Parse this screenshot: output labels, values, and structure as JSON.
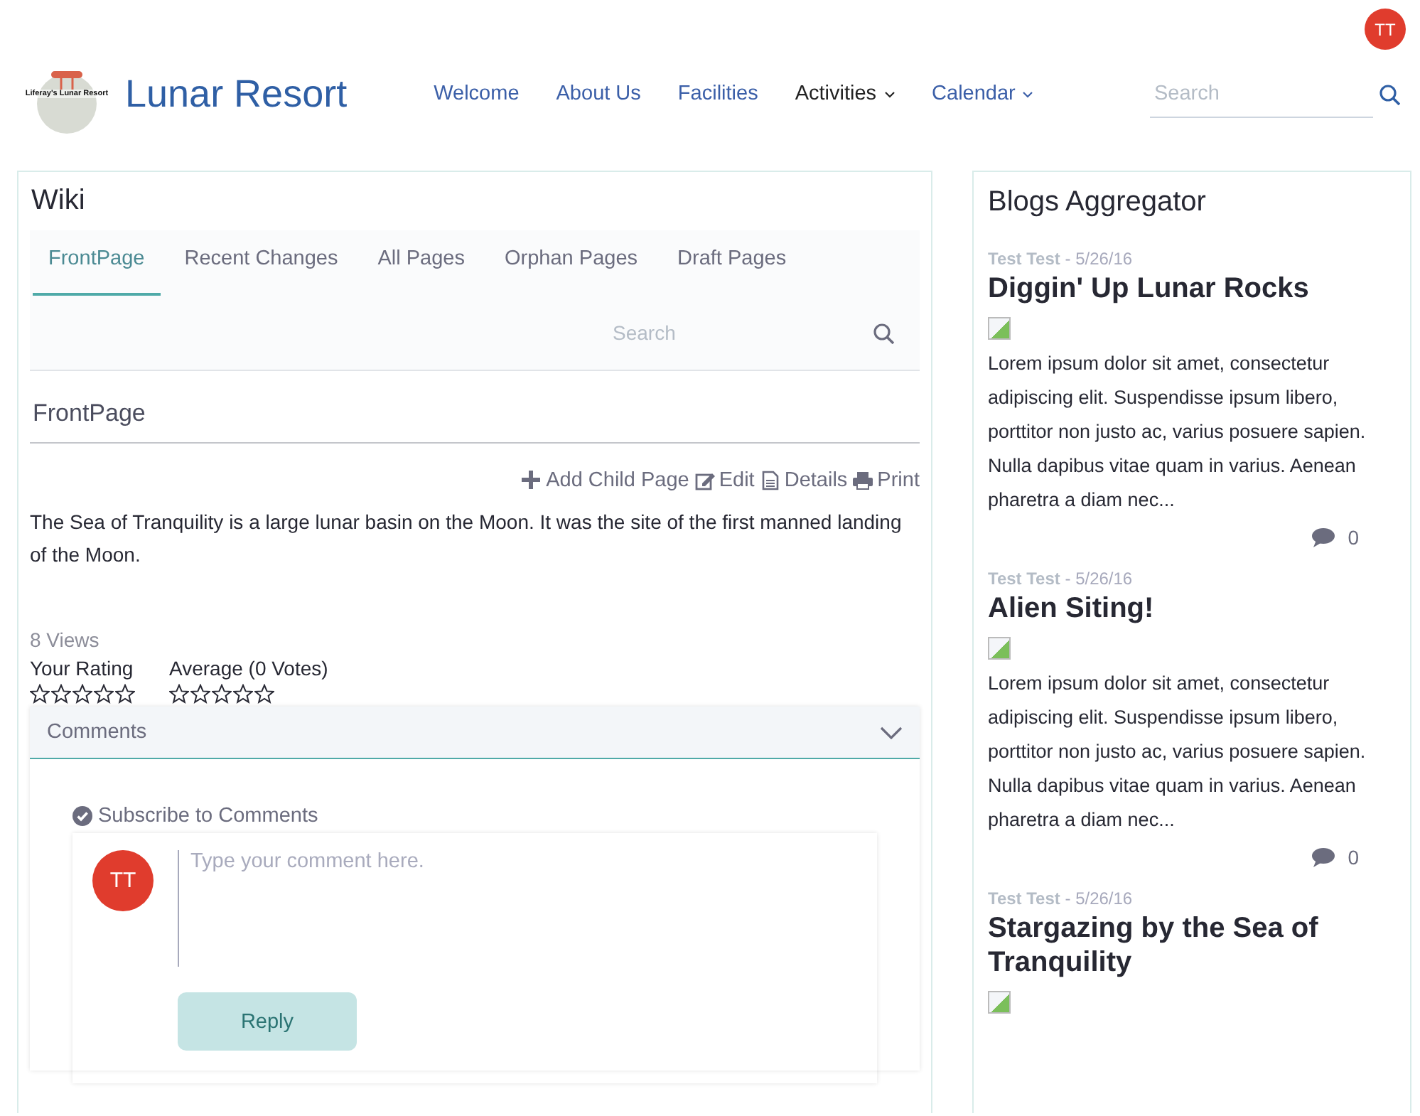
{
  "header": {
    "user_initials": "TT",
    "logo_text": "Liferay's Lunar Resort",
    "site_title": "Lunar Resort",
    "nav": [
      {
        "label": "Welcome",
        "selected": false,
        "kind": "link"
      },
      {
        "label": "About Us",
        "selected": false,
        "kind": "link"
      },
      {
        "label": "Facilities",
        "selected": false,
        "kind": "link"
      },
      {
        "label": "Activities",
        "selected": true,
        "kind": "dropdown"
      },
      {
        "label": "Calendar",
        "selected": false,
        "kind": "dropdown"
      }
    ],
    "search": {
      "placeholder": "Search"
    }
  },
  "wiki": {
    "title": "Wiki",
    "tabs": [
      {
        "label": "FrontPage",
        "selected": true
      },
      {
        "label": "Recent Changes",
        "selected": false
      },
      {
        "label": "All Pages",
        "selected": false
      },
      {
        "label": "Orphan Pages",
        "selected": false
      },
      {
        "label": "Draft Pages",
        "selected": false
      }
    ],
    "search": {
      "placeholder": "Search"
    },
    "page_title": "FrontPage",
    "actions": [
      {
        "label": "Add Child Page",
        "kind": "add"
      },
      {
        "label": "Edit",
        "kind": "edit"
      },
      {
        "label": "Details",
        "kind": "details"
      },
      {
        "label": "Print",
        "kind": "print"
      }
    ],
    "content": "The Sea of Tranquility is a large lunar basin on the Moon. It was the site of the first manned landing of the Moon.",
    "views": "8 Views",
    "ratings": [
      {
        "label": "Your Rating",
        "stars": 0
      },
      {
        "label": "Average (0 Votes)",
        "stars": 0
      }
    ],
    "comments": {
      "title": "Comments",
      "expanded": true,
      "subscribe": "Subscribe to Comments",
      "user_initials": "TT",
      "placeholder": "Type your comment here.",
      "reply": "Reply",
      "reply_disabled": true
    }
  },
  "blogs": {
    "title": "Blogs Aggregator",
    "posts": [
      {
        "author": "Test Test",
        "date": "- 5/26/16",
        "title": "Diggin' Up Lunar Rocks",
        "excerpt": "Lorem ipsum dolor sit amet, consectetur adipiscing elit. Suspendisse ipsum libero, porttitor non justo ac, varius posuere sapien. Nulla dapibus vitae quam in varius. Aenean pharetra a diam nec...",
        "comment_count": "0"
      },
      {
        "author": "Test Test",
        "date": "- 5/26/16",
        "title": "Alien Siting!",
        "excerpt": "Lorem ipsum dolor sit amet, consectetur adipiscing elit. Suspendisse ipsum libero, porttitor non justo ac, varius posuere sapien. Nulla dapibus vitae quam in varius. Aenean pharetra a diam nec...",
        "comment_count": "0"
      },
      {
        "author": "Test Test",
        "date": "- 5/26/16",
        "title": "Stargazing by the Sea of Tranquility"
      }
    ]
  }
}
